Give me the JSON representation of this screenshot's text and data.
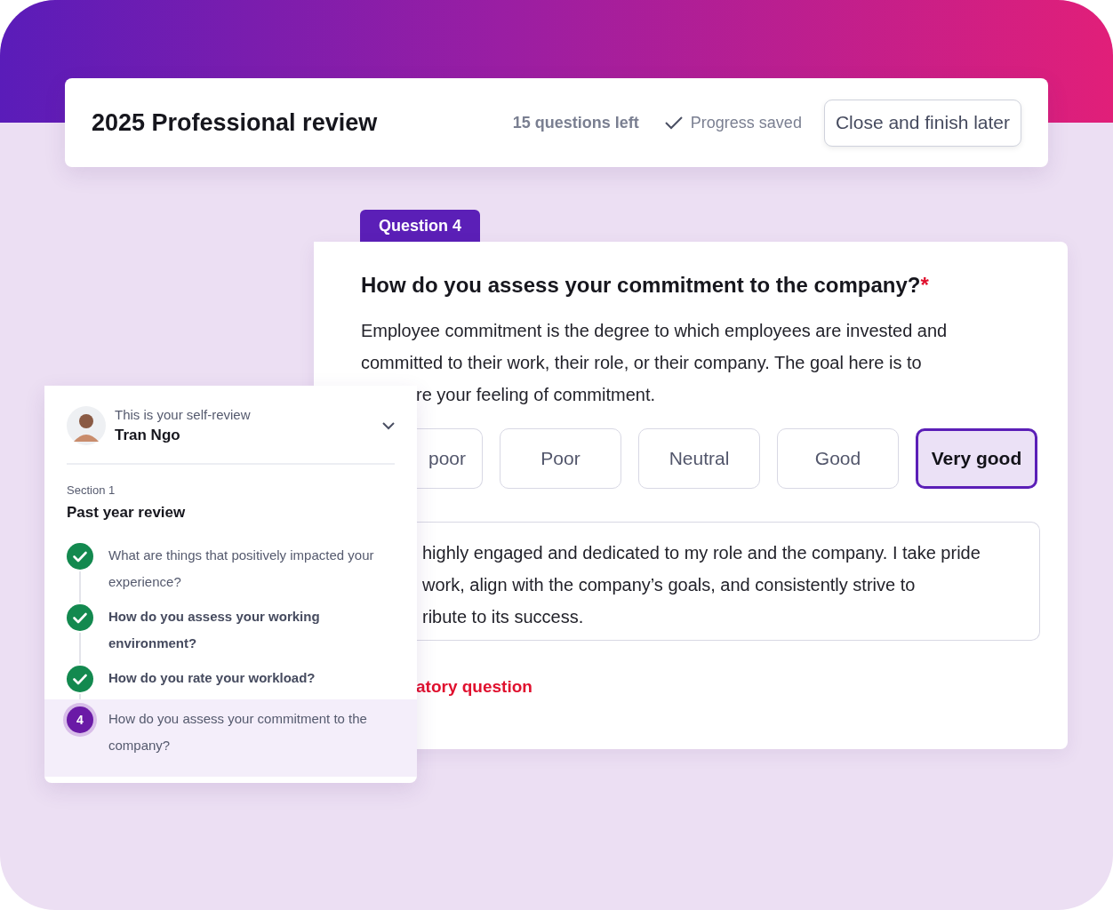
{
  "header": {
    "title": "2025 Professional review",
    "questions_left": "15 questions left",
    "saved_status": "Progress saved",
    "close_button": "Close and finish later"
  },
  "question": {
    "tab": "Question 4",
    "title": "How do you assess your commitment to the company?",
    "required_mark": "*",
    "description": "Employee commitment is the degree to which employees are invested and committed to their work, their role, or their company. The goal here is to",
    "description_tail": "re your feeling of commitment.",
    "options": [
      {
        "label": "poor",
        "selected": false,
        "partly_hidden": true
      },
      {
        "label": "Poor",
        "selected": false,
        "partly_hidden": false
      },
      {
        "label": "Neutral",
        "selected": false,
        "partly_hidden": false
      },
      {
        "label": "Good",
        "selected": false,
        "partly_hidden": false
      },
      {
        "label": "Very good",
        "selected": true,
        "partly_hidden": false
      }
    ],
    "answer_lines": [
      "highly engaged and dedicated to my role and the company. I take pride",
      "work, align with the company’s goals, and consistently strive to",
      "ribute to its success."
    ],
    "error": "atory question"
  },
  "sidebar": {
    "subtitle": "This is your self-review",
    "name": "Tran Ngo",
    "section_label": "Section 1",
    "section_title": "Past year review",
    "steps": [
      {
        "text": "What are things that positively impacted your experience?",
        "kind": "done",
        "bold": false,
        "selected": false
      },
      {
        "text": "How do you assess your working environment?",
        "kind": "done",
        "bold": true,
        "selected": false
      },
      {
        "text": "How do you rate your workload?",
        "kind": "done",
        "bold": true,
        "selected": false
      },
      {
        "text": "How do you assess your commitment to the company?",
        "kind": "current",
        "number": "4",
        "bold": false,
        "selected": true
      }
    ]
  }
}
